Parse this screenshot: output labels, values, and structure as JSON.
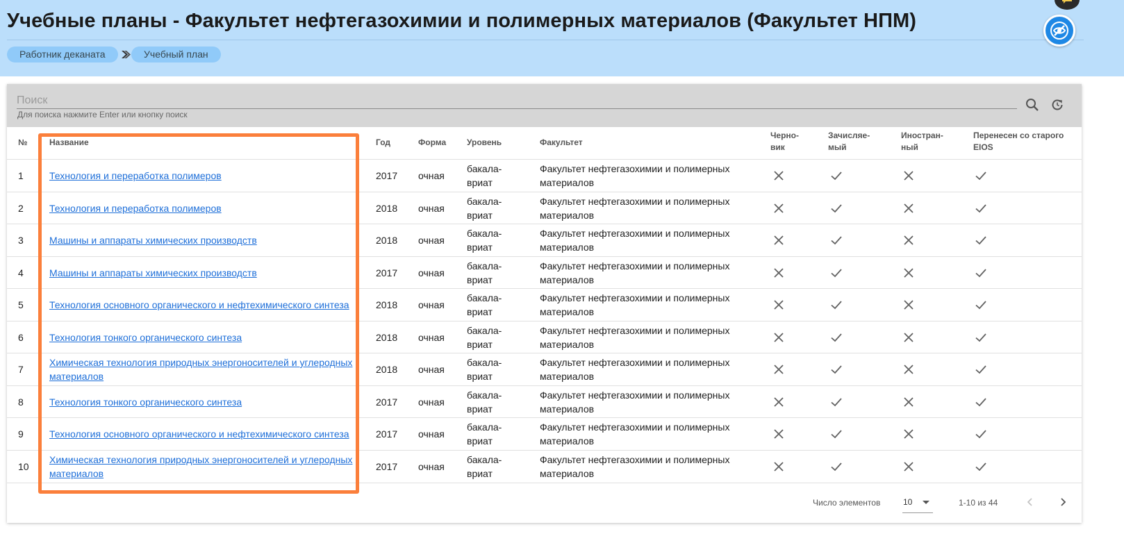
{
  "header": {
    "title": "Учебные планы - Факультет нефтегазохимии и полимерных материалов (Факультет НПМ)",
    "breadcrumbs": [
      "Работник деканата",
      "Учебный план"
    ]
  },
  "search": {
    "placeholder": "Поиск",
    "value": "",
    "hint": "Для поиска нажмите Enter или кнопку поиск"
  },
  "table": {
    "columns": [
      "№",
      "Название",
      "Год",
      "Форма",
      "Уровень",
      "Факультет",
      "Черно-вик",
      "Зачисляе-мый",
      "Иностран-ный",
      "Перенесен со старого EIOS"
    ],
    "column_lines": [
      [
        "№"
      ],
      [
        "Название"
      ],
      [
        "Год"
      ],
      [
        "Форма"
      ],
      [
        "Уровень"
      ],
      [
        "Факультет"
      ],
      [
        "Черно-",
        "вик"
      ],
      [
        "Зачисляе-",
        "мый"
      ],
      [
        "Иностран-",
        "ный"
      ],
      [
        "Перенесен со старого",
        "EIOS"
      ]
    ],
    "rows": [
      {
        "num": "1",
        "name": "Технология и переработка полимеров",
        "year": "2017",
        "form": "очная",
        "level": [
          "бакала-",
          "вриат"
        ],
        "faculty": [
          "Факультет нефтегазохимии и полимерных",
          "материалов"
        ],
        "draft": false,
        "enrolling": true,
        "foreign": false,
        "transferred": true
      },
      {
        "num": "2",
        "name": "Технология и переработка полимеров",
        "year": "2018",
        "form": "очная",
        "level": [
          "бакала-",
          "вриат"
        ],
        "faculty": [
          "Факультет нефтегазохимии и полимерных",
          "материалов"
        ],
        "draft": false,
        "enrolling": true,
        "foreign": false,
        "transferred": true
      },
      {
        "num": "3",
        "name": "Машины и аппараты химических производств",
        "year": "2018",
        "form": "очная",
        "level": [
          "бакала-",
          "вриат"
        ],
        "faculty": [
          "Факультет нефтегазохимии и полимерных",
          "материалов"
        ],
        "draft": false,
        "enrolling": true,
        "foreign": false,
        "transferred": true
      },
      {
        "num": "4",
        "name": "Машины и аппараты химических производств",
        "year": "2017",
        "form": "очная",
        "level": [
          "бакала-",
          "вриат"
        ],
        "faculty": [
          "Факультет нефтегазохимии и полимерных",
          "материалов"
        ],
        "draft": false,
        "enrolling": true,
        "foreign": false,
        "transferred": true
      },
      {
        "num": "5",
        "name": "Технология основного органического и нефтехимического синтеза",
        "year": "2018",
        "form": "очная",
        "level": [
          "бакала-",
          "вриат"
        ],
        "faculty": [
          "Факультет нефтегазохимии и полимерных",
          "материалов"
        ],
        "draft": false,
        "enrolling": true,
        "foreign": false,
        "transferred": true
      },
      {
        "num": "6",
        "name": "Технология тонкого органического синтеза",
        "year": "2018",
        "form": "очная",
        "level": [
          "бакала-",
          "вриат"
        ],
        "faculty": [
          "Факультет нефтегазохимии и полимерных",
          "материалов"
        ],
        "draft": false,
        "enrolling": true,
        "foreign": false,
        "transferred": true
      },
      {
        "num": "7",
        "name": "Химическая технология природных энергоносителей и углеродных материалов",
        "year": "2018",
        "form": "очная",
        "level": [
          "бакала-",
          "вриат"
        ],
        "faculty": [
          "Факультет нефтегазохимии и полимерных",
          "материалов"
        ],
        "draft": false,
        "enrolling": true,
        "foreign": false,
        "transferred": true
      },
      {
        "num": "8",
        "name": "Технология тонкого органического синтеза",
        "year": "2017",
        "form": "очная",
        "level": [
          "бакала-",
          "вриат"
        ],
        "faculty": [
          "Факультет нефтегазохимии и полимерных",
          "материалов"
        ],
        "draft": false,
        "enrolling": true,
        "foreign": false,
        "transferred": true
      },
      {
        "num": "9",
        "name": "Технология основного органического и нефтехимического синтеза",
        "year": "2017",
        "form": "очная",
        "level": [
          "бакала-",
          "вриат"
        ],
        "faculty": [
          "Факультет нефтегазохимии и полимерных",
          "материалов"
        ],
        "draft": false,
        "enrolling": true,
        "foreign": false,
        "transferred": true
      },
      {
        "num": "10",
        "name": "Химическая технология природных энергоносителей и углеродных материалов",
        "year": "2017",
        "form": "очная",
        "level": [
          "бакала-",
          "вриат"
        ],
        "faculty": [
          "Факультет нефтегазохимии и полимерных",
          "материалов"
        ],
        "draft": false,
        "enrolling": true,
        "foreign": false,
        "transferred": true
      }
    ]
  },
  "pagination": {
    "page_size_label": "Число элементов",
    "page_size": "10",
    "range": "1-10 из 44"
  },
  "icons": {
    "eye": "eye-off-icon",
    "chat": "chat-icon",
    "search": "search-icon",
    "reset": "reset-icon",
    "true_value": "check-icon",
    "false_value": "close-icon"
  },
  "colors": {
    "header_bg": "#bbdefb",
    "breadcrumb_bg": "#90caf9",
    "link": "#1e6fd9",
    "accent_button": "#1e88e5",
    "highlight_border": "#fb7f3b",
    "search_bar_bg": "#d6d6d6"
  }
}
